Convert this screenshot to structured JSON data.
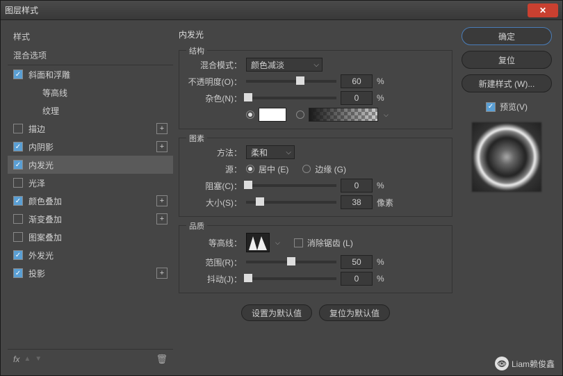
{
  "window": {
    "title": "图层样式"
  },
  "left": {
    "styles_header": "样式",
    "blend_header": "混合选项",
    "items": [
      {
        "label": "斜面和浮雕",
        "checked": true,
        "plus": false,
        "indent": false
      },
      {
        "label": "等高线",
        "checked": false,
        "plus": false,
        "indent": true
      },
      {
        "label": "纹理",
        "checked": false,
        "plus": false,
        "indent": true
      },
      {
        "label": "描边",
        "checked": false,
        "plus": true,
        "indent": false
      },
      {
        "label": "内阴影",
        "checked": true,
        "plus": true,
        "indent": false
      },
      {
        "label": "内发光",
        "checked": true,
        "plus": false,
        "selected": true,
        "indent": false
      },
      {
        "label": "光泽",
        "checked": false,
        "plus": false,
        "indent": false
      },
      {
        "label": "颜色叠加",
        "checked": true,
        "plus": true,
        "indent": false
      },
      {
        "label": "渐变叠加",
        "checked": false,
        "plus": true,
        "indent": false
      },
      {
        "label": "图案叠加",
        "checked": false,
        "plus": false,
        "indent": false
      },
      {
        "label": "外发光",
        "checked": true,
        "plus": false,
        "indent": false
      },
      {
        "label": "投影",
        "checked": true,
        "plus": true,
        "indent": false
      }
    ],
    "fx_label": "fx"
  },
  "center": {
    "title": "内发光",
    "structure": {
      "group_label": "结构",
      "blend_mode_label": "混合模式：",
      "blend_mode_value": "颜色减淡",
      "opacity_label": "不透明度(O)：",
      "opacity_value": "60",
      "opacity_unit": "%",
      "noise_label": "杂色(N)：",
      "noise_value": "0",
      "noise_unit": "%"
    },
    "elements": {
      "group_label": "图素",
      "technique_label": "方法：",
      "technique_value": "柔和",
      "source_label": "源：",
      "source_center": "居中 (E)",
      "source_edge": "边缘 (G)",
      "choke_label": "阻塞(C)：",
      "choke_value": "0",
      "choke_unit": "%",
      "size_label": "大小(S)：",
      "size_value": "38",
      "size_unit": "像素"
    },
    "quality": {
      "group_label": "品质",
      "contour_label": "等高线：",
      "antialias_label": "消除锯齿 (L)",
      "range_label": "范围(R)：",
      "range_value": "50",
      "range_unit": "%",
      "jitter_label": "抖动(J)：",
      "jitter_value": "0",
      "jitter_unit": "%"
    },
    "buttons": {
      "default": "设置为默认值",
      "reset": "复位为默认值"
    }
  },
  "right": {
    "ok": "确定",
    "cancel": "复位",
    "new_style": "新建样式 (W)...",
    "preview": "预览(V)"
  },
  "watermark": "Liam赖俊鑫"
}
